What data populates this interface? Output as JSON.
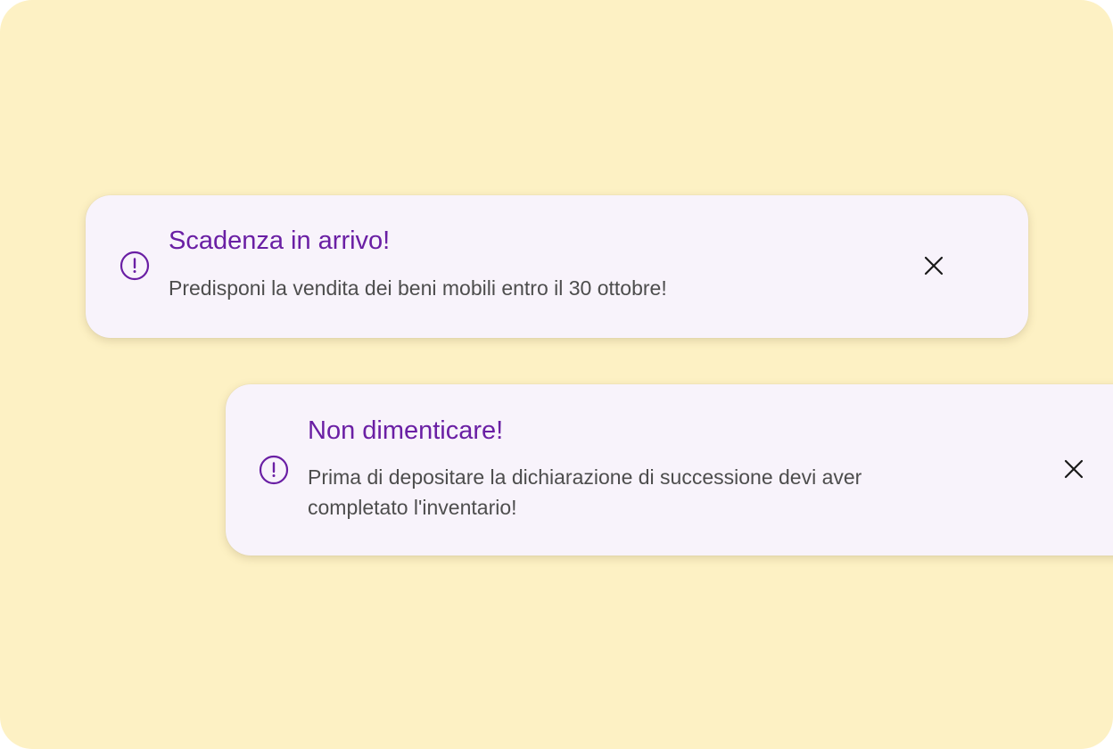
{
  "colors": {
    "background": "#fdf1c4",
    "toast_background": "#f8f3fb",
    "accent": "#6a1fa4",
    "message_text": "#4d4d4d",
    "close_icon": "#1a1a1a"
  },
  "notifications": [
    {
      "icon": "alert-circle-icon",
      "title": "Scadenza in arrivo!",
      "message": "Predisponi la vendita dei beni mobili entro il 30 ottobre!",
      "close_icon": "close-icon"
    },
    {
      "icon": "alert-circle-icon",
      "title": "Non dimenticare!",
      "message": "Prima di depositare la dichiarazione di successione devi aver completato l'inventario!",
      "close_icon": "close-icon"
    }
  ]
}
